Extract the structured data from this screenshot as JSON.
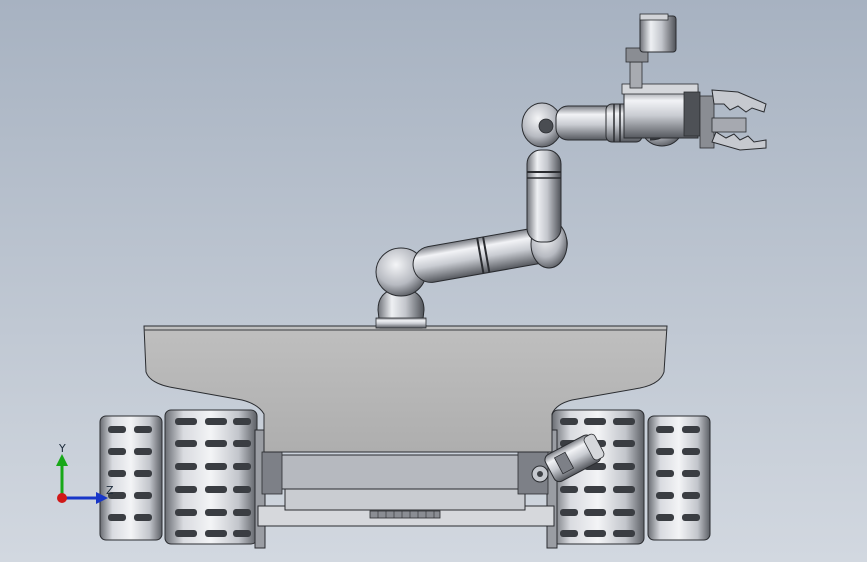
{
  "viewport": {
    "background_top": "#a7b2c1",
    "background_bottom": "#d2d8e0"
  },
  "triad": {
    "y_label": "Y",
    "z_label": "Z",
    "x_color": "#d01818",
    "y_color": "#18a818",
    "z_color": "#1836c8"
  },
  "model": {
    "colors": {
      "chassis": "#b8b8b8",
      "metal_light": "#e6e8ec",
      "metal_mid": "#a6a9b0",
      "metal_dark": "#5a5d63",
      "outline": "#2a2c30"
    },
    "icons": [
      "robot-arm",
      "gripper",
      "camera",
      "track-wheel",
      "chassis-body"
    ]
  }
}
